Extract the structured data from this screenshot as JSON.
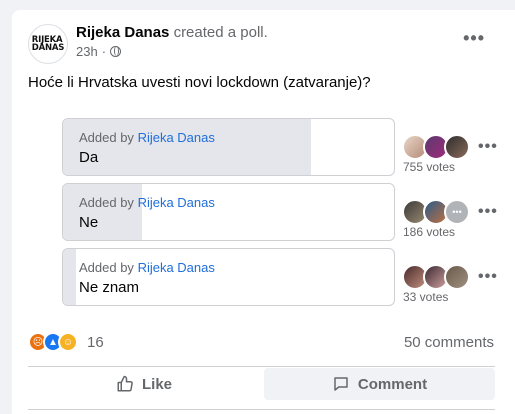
{
  "post": {
    "page_name": "Rijeka Danas",
    "action_text": "created a poll.",
    "time": "23h",
    "privacy_icon": "globe-icon",
    "logo_text_line1": "RIJEKA",
    "logo_text_line2": "DANAS",
    "question": "Hoće li Hrvatska uvesti novi lockdown (zatvaranje)?"
  },
  "poll": {
    "options": [
      {
        "added_by_prefix": "Added by",
        "added_by": "Rijeka Danas",
        "label": "Da",
        "votes": "755 votes",
        "share": 0.75
      },
      {
        "added_by_prefix": "Added by",
        "added_by": "Rijeka Danas",
        "label": "Ne",
        "votes": "186 votes",
        "share": 0.24
      },
      {
        "added_by_prefix": "Added by",
        "added_by": "Rijeka Danas",
        "label": "Ne znam",
        "votes": "33 votes",
        "share": 0.04
      }
    ]
  },
  "footer": {
    "reaction_icons": [
      "angry-icon",
      "like-icon",
      "haha-icon"
    ],
    "reaction_count": "16",
    "comments": "50 comments",
    "like_label": "Like",
    "comment_label": "Comment"
  },
  "colors": {
    "link_blue": "#216fdb",
    "muted": "#65676b",
    "fill": "#e4e6eb"
  }
}
